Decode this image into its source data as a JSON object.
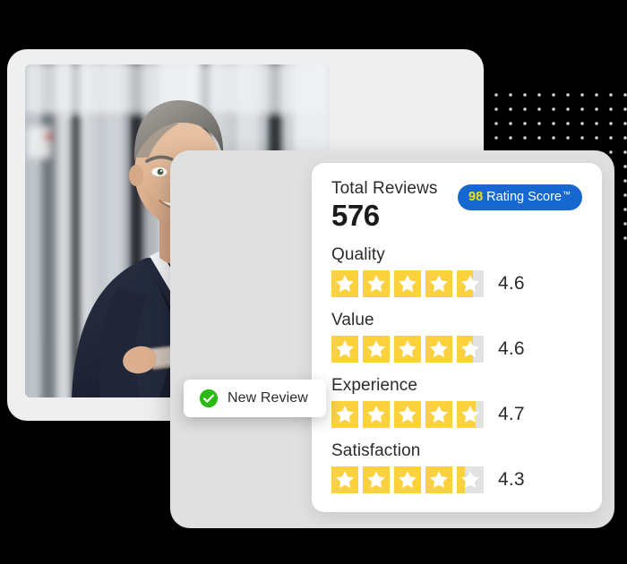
{
  "colors": {
    "background": "#000000",
    "card_white": "#ffffff",
    "card_gray": "#e0e0e0",
    "photo_frame": "#efefef",
    "pill_blue": "#1668d0",
    "pill_score_yellow": "#f2e300",
    "star_filled": "#fbd13d",
    "star_empty": "#e2e2e2",
    "check_green": "#2bb914",
    "dot_grid": "#d3d3d3",
    "text_dark": "#2b2b2b"
  },
  "ratings_card": {
    "total_reviews_label": "Total Reviews",
    "total_reviews_value": "576",
    "score_pill": {
      "score": "98",
      "text": "Rating Score",
      "trademark": "™"
    },
    "rows": [
      {
        "name": "Quality",
        "score": "4.6",
        "stars": 4.6
      },
      {
        "name": "Value",
        "score": "4.6",
        "stars": 4.6
      },
      {
        "name": "Experience",
        "score": "4.7",
        "stars": 4.7
      },
      {
        "name": "Satisfaction",
        "score": "4.3",
        "stars": 4.3
      }
    ]
  },
  "toast": {
    "icon": "check-circle-icon",
    "label": "New Review"
  },
  "photo": {
    "alt": "Smiling businessman in navy suit holding a tablet in a modern office lobby"
  },
  "decor": {
    "dot_grid": "dot-grid-pattern"
  }
}
